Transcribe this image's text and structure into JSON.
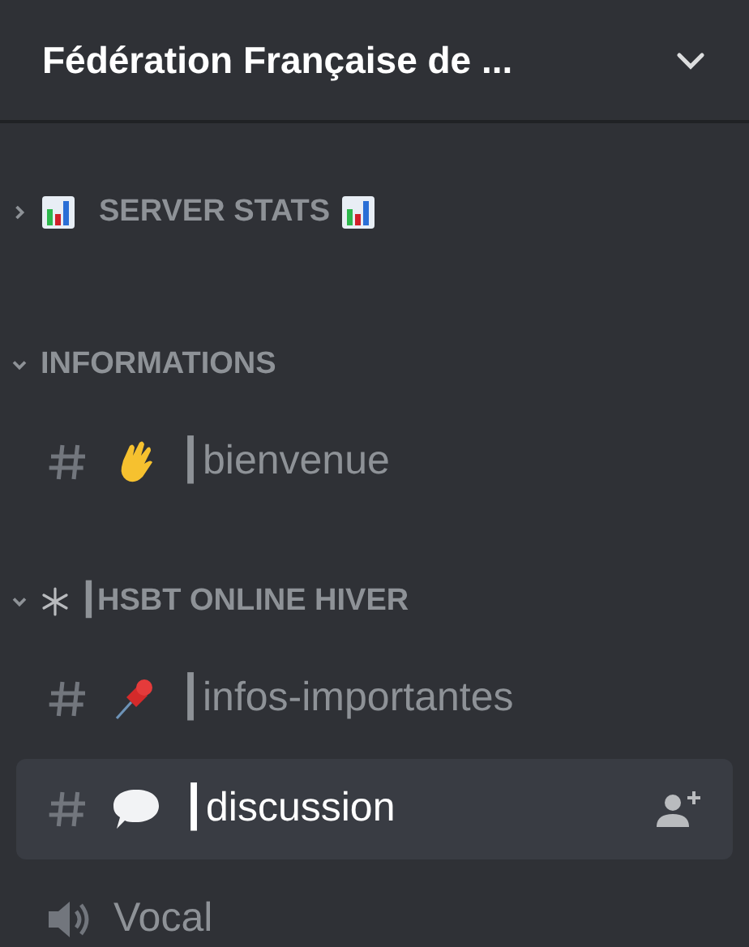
{
  "server": {
    "title": "Fédération Française de ..."
  },
  "categories": [
    {
      "name": "SERVER STATS",
      "expanded": false
    },
    {
      "name": "INFORMATIONS",
      "expanded": true,
      "channels": [
        {
          "kind": "text",
          "name": "┃bienvenue",
          "selected": false
        }
      ]
    },
    {
      "name": "┃HSBT ONLINE HIVER",
      "expanded": true,
      "channels": [
        {
          "kind": "text",
          "name": "┃infos-importantes",
          "selected": false
        },
        {
          "kind": "text",
          "name": "┃discussion",
          "selected": true
        },
        {
          "kind": "voice",
          "name": "Vocal",
          "selected": false
        }
      ]
    }
  ]
}
